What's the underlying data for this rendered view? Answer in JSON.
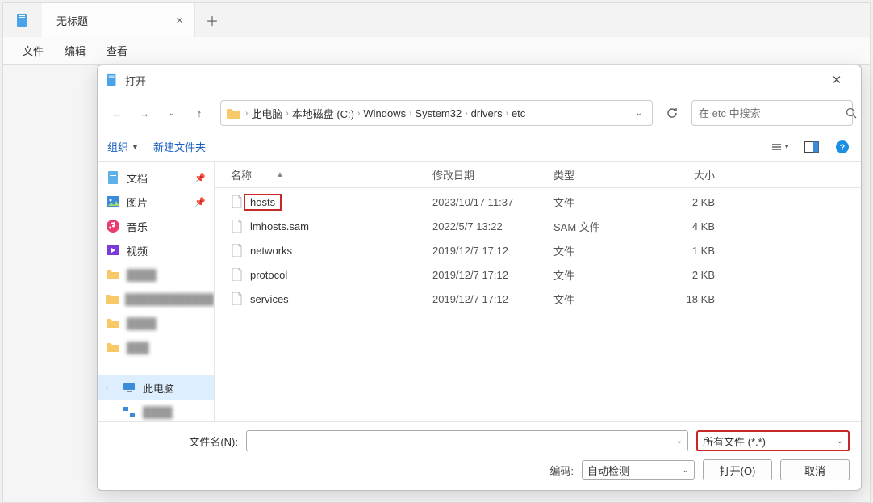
{
  "app": {
    "tab_title": "无标题",
    "menu": {
      "file": "文件",
      "edit": "编辑",
      "view": "查看"
    }
  },
  "dialog": {
    "title": "打开",
    "breadcrumb": [
      "此电脑",
      "本地磁盘 (C:)",
      "Windows",
      "System32",
      "drivers",
      "etc"
    ],
    "search_placeholder": "在 etc 中搜索",
    "toolbar": {
      "organize": "组织",
      "newfolder": "新建文件夹"
    },
    "sidebar": {
      "docs": "文档",
      "pics": "图片",
      "music": "音乐",
      "videos": "视频",
      "thispc": "此电脑",
      "network": "网络"
    },
    "columns": {
      "name": "名称",
      "date": "修改日期",
      "type": "类型",
      "size": "大小"
    },
    "files": [
      {
        "name": "hosts",
        "date": "2023/10/17 11:37",
        "type": "文件",
        "size": "2 KB",
        "hl": true
      },
      {
        "name": "lmhosts.sam",
        "date": "2022/5/7 13:22",
        "type": "SAM 文件",
        "size": "4 KB",
        "hl": false
      },
      {
        "name": "networks",
        "date": "2019/12/7 17:12",
        "type": "文件",
        "size": "1 KB",
        "hl": false
      },
      {
        "name": "protocol",
        "date": "2019/12/7 17:12",
        "type": "文件",
        "size": "2 KB",
        "hl": false
      },
      {
        "name": "services",
        "date": "2019/12/7 17:12",
        "type": "文件",
        "size": "18 KB",
        "hl": false
      }
    ],
    "filename_label": "文件名(N):",
    "filetype": "所有文件  (*.*)",
    "encoding_label": "编码:",
    "encoding": "自动检测",
    "open_btn": "打开(O)",
    "cancel_btn": "取消"
  }
}
